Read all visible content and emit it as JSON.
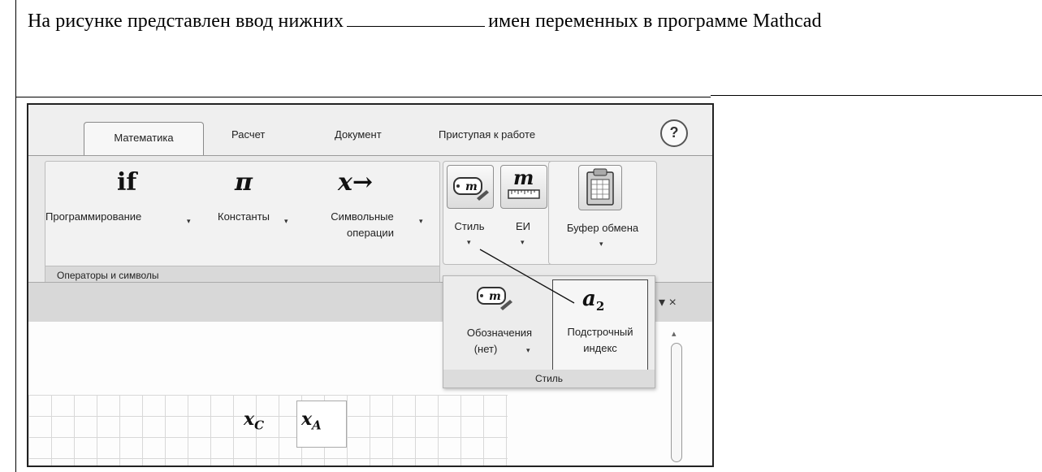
{
  "question": {
    "before": "На рисунке представлен ввод нижних",
    "after": "имен переменных в программе Mathcad"
  },
  "tabs": [
    "Математика",
    "Расчет",
    "Документ",
    "Приступая к работе"
  ],
  "help_label": "?",
  "ribbon": {
    "programming": {
      "symbol": "if",
      "label": "Программирование"
    },
    "constants": {
      "symbol": "π",
      "label": "Константы"
    },
    "symbolic": {
      "symbol": "x→",
      "label1": "Символьные",
      "label2": "операции"
    },
    "group_caption": "Операторы и символы",
    "style_label": "Стиль",
    "style_icon_text": "m",
    "units_symbol": "m",
    "units_label": "ЕИ",
    "clipboard_label": "Буфер обмена",
    "dropdown_arrow": "▾"
  },
  "popup": {
    "notation_icon_text": "m",
    "notation_label1": "Обозначения",
    "notation_label2": "(нет)",
    "subscript_symbol": "a",
    "subscript_index": "2",
    "subscript_label1": "Подстрочный",
    "subscript_label2": "индекс",
    "caption": "Стиль"
  },
  "pane_controls": "▾ ×",
  "workspace": {
    "var1_base": "x",
    "var1_sub": "C",
    "var2_base": "x",
    "var2_sub": "A"
  },
  "scroll_up": "▴"
}
